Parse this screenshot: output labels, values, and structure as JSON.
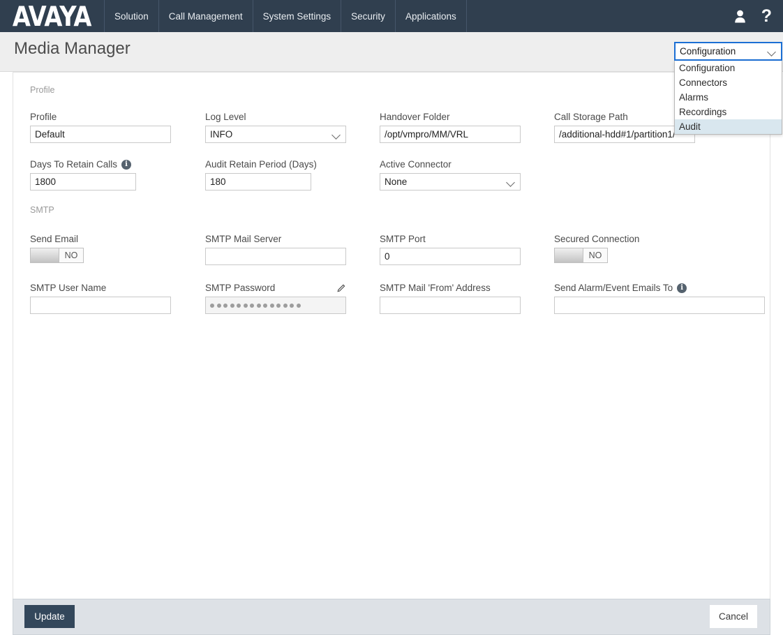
{
  "topnav": {
    "logo": "AVAYA",
    "items": [
      {
        "label": "Solution"
      },
      {
        "label": "Call Management"
      },
      {
        "label": "System Settings"
      },
      {
        "label": "Security"
      },
      {
        "label": "Applications"
      }
    ],
    "user_icon": "user-icon",
    "help_icon": "help-icon",
    "help_glyph": "?",
    "background_color": "#303f4f"
  },
  "header": {
    "title": "Media Manager"
  },
  "module_select": {
    "value": "Configuration",
    "focus_border_color": "#1b6fd4",
    "highlight_color": "#d9e7ef",
    "options": [
      {
        "label": "Configuration",
        "highlighted": false
      },
      {
        "label": "Connectors",
        "highlighted": false
      },
      {
        "label": "Alarms",
        "highlighted": false
      },
      {
        "label": "Recordings",
        "highlighted": false
      },
      {
        "label": "Audit",
        "highlighted": true
      }
    ]
  },
  "sections": {
    "profile": {
      "title": "Profile",
      "fields": {
        "profile": {
          "label": "Profile",
          "value": "Default"
        },
        "log_level": {
          "label": "Log Level",
          "value": "INFO"
        },
        "handover_folder": {
          "label": "Handover Folder",
          "value": "/opt/vmpro/MM/VRL"
        },
        "call_storage_path": {
          "label": "Call Storage Path",
          "value": "/additional-hdd#1/partition1/"
        },
        "days_to_retain_calls": {
          "label": "Days To Retain Calls",
          "value": "1800",
          "info": "info-icon"
        },
        "audit_retain_period": {
          "label": "Audit Retain Period (Days)",
          "value": "180"
        },
        "active_connector": {
          "label": "Active Connector",
          "value": "None"
        }
      }
    },
    "smtp": {
      "title": "SMTP",
      "fields": {
        "send_email": {
          "label": "Send Email",
          "value": "NO"
        },
        "smtp_mail_server": {
          "label": "SMTP Mail Server",
          "value": ""
        },
        "smtp_port": {
          "label": "SMTP Port",
          "value": "0"
        },
        "secured_connection": {
          "label": "Secured Connection",
          "value": "NO"
        },
        "smtp_user_name": {
          "label": "SMTP User Name",
          "value": ""
        },
        "smtp_password": {
          "label": "SMTP Password",
          "value": "",
          "masked_dots": 14,
          "edit_icon": "pencil-icon"
        },
        "smtp_mail_from_address": {
          "label": "SMTP Mail 'From' Address",
          "value": ""
        },
        "send_alarm_event_emails_to": {
          "label": "Send Alarm/Event Emails To",
          "value": "",
          "info": "info-icon"
        }
      }
    }
  },
  "footer": {
    "update_label": "Update",
    "cancel_label": "Cancel",
    "update_color": "#33475b"
  }
}
